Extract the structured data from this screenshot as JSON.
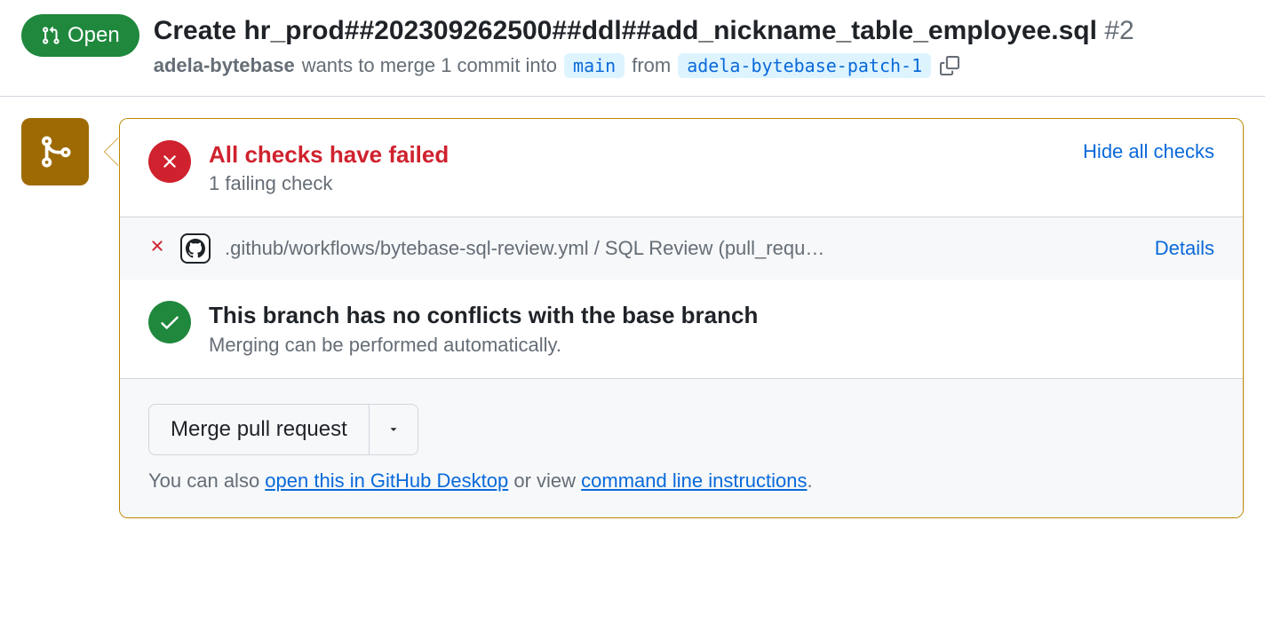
{
  "header": {
    "state": "Open",
    "title": "Create hr_prod##202309262500##ddl##add_nickname_table_employee.sql",
    "number": "#2",
    "author": "adela-bytebase",
    "wants_label": "wants to merge 1 commit into",
    "base_branch": "main",
    "from_label": "from",
    "head_branch": "adela-bytebase-patch-1"
  },
  "checks": {
    "title": "All checks have failed",
    "subtitle": "1 failing check",
    "toggle": "Hide all checks",
    "items": [
      {
        "name": ".github/workflows/bytebase-sql-review.yml / SQL Review (pull_requ…",
        "details": "Details"
      }
    ]
  },
  "conflicts": {
    "title": "This branch has no conflicts with the base branch",
    "subtitle": "Merging can be performed automatically."
  },
  "merge": {
    "button": "Merge pull request",
    "help_prefix": "You can also ",
    "desktop_link": "open this in GitHub Desktop",
    "help_mid": " or view ",
    "cli_link": "command line instructions",
    "period": "."
  }
}
